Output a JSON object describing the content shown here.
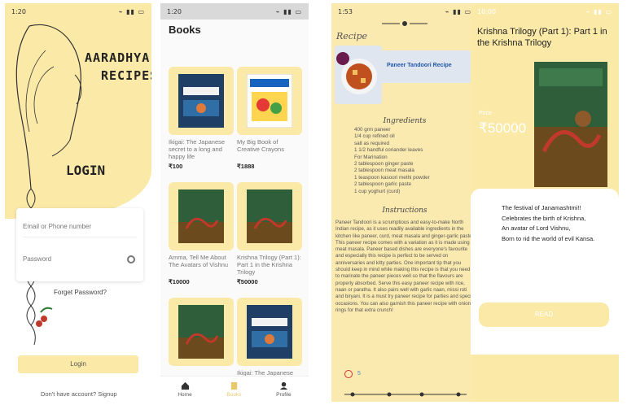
{
  "colors": {
    "accent": "#fbe9a8",
    "accent_dark": "#e9c76a",
    "recipe_bg": "#fbeab0"
  },
  "login": {
    "status_time": "1:20",
    "brand_line1": "AARADHYA",
    "brand_line2": "RECIPES",
    "title": "LOGIN",
    "email_placeholder": "Email or Phone number",
    "password_placeholder": "Password",
    "forgot": "Forget Password?",
    "login_button": "Login",
    "signup": "Don't have account? Signup"
  },
  "books": {
    "status_time": "1:20",
    "title": "Books",
    "items": [
      {
        "title": "Ikigai: The Japanese secret to a long and happy life",
        "price": "₹100",
        "cover_icon": "ikigai-cover"
      },
      {
        "title": "My Big Book of Creative Crayons",
        "price": "₹1888",
        "cover_icon": "crayons-cover"
      },
      {
        "title": "Amma, Tell Me About The Avatars of Vishnu",
        "price": "₹10000",
        "cover_icon": "krishna-cover"
      },
      {
        "title": "Krishna Trilogy (Part 1): Part 1 in the Krishna Trilogy",
        "price": "₹50000",
        "cover_icon": "krishna-cover"
      },
      {
        "title": "",
        "price": "",
        "cover_icon": "krishna-cover"
      },
      {
        "title": "Ikigai: The Japanese",
        "price": "",
        "cover_icon": "ikigai-cover"
      }
    ],
    "nav": [
      {
        "label": "Home",
        "icon": "home-icon"
      },
      {
        "label": "Books",
        "icon": "book-icon"
      },
      {
        "label": "Profile",
        "icon": "profile-icon"
      }
    ]
  },
  "recipe": {
    "status_time": "1:53",
    "header": "Recipe",
    "dish_name": "Paneer Tandoori Recipe",
    "ingredients_title": "Ingredients",
    "ingredients": [
      "400 grm paneer",
      "1/4 cup refined oil",
      "salt as required",
      "1 1/2 handful coriander leaves",
      "For Marination",
      "2 tablespoon ginger paste",
      "2 tablespoon meat masala",
      "1 teaspoon kasoori methi powder",
      "2 tablespoon garlic paste",
      "1 cup yoghurt (curd)"
    ],
    "instructions_title": "Instructions",
    "instructions": "Paneer Tandoori is a scrumptious and easy-to-make North Indian recipe, as it uses readily available ingredients in the kitchen like paneer, curd, meat masala and ginger-garlic paste. This paneer recipe comes with a variation as it is made using meat masala. Paneer based dishes are everyone's favourite and especially this recipe is perfect to be served on anniversaries and kitty parties. One important tip that you should keep in mind while making this recipe is that you need to marinate the paneer pieces well so that the flavours are properly absorbed. Serve this easy paneer recipe with rice, naan or paratha. It also pairs well with garlic naan, missi roti and biryani. It is a must try paneer recipe for parties and special occasions. You can also garnish this paneer recipe with onions rings for that extra crunch!",
    "likes": "5"
  },
  "detail": {
    "status_time": "10:00",
    "title": "Krishna Trilogy (Part 1): Part 1 in the Krishna Trilogy",
    "price_label": "Price",
    "price": "₹50000",
    "poem": [
      "The festival of Janamashtmi!!",
      "Celebrates the birth of Krishna,",
      "An avatar of Lord Vishnu,",
      "Born to rid the world of evil Kansa."
    ],
    "read_button": "READ"
  }
}
